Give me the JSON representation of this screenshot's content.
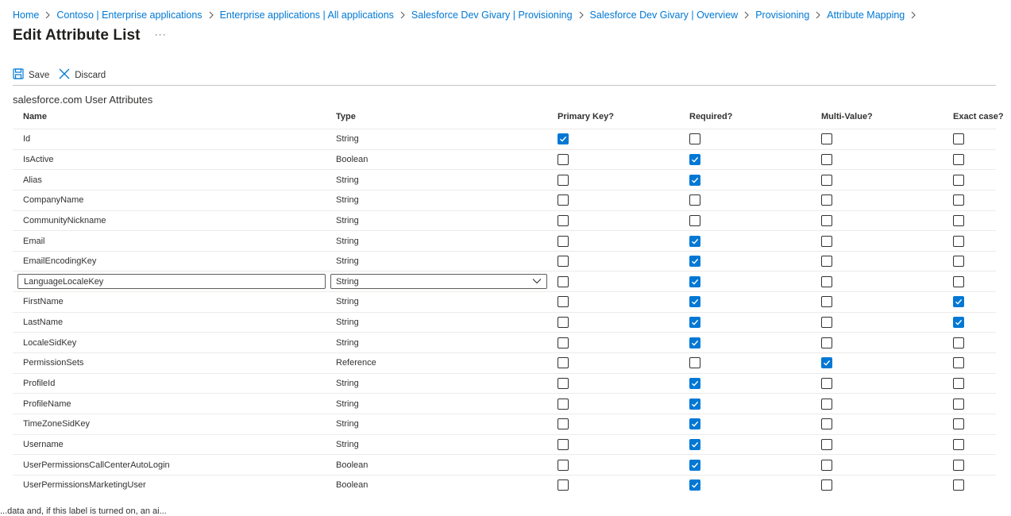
{
  "breadcrumb": [
    "Home",
    "Contoso | Enterprise applications",
    "Enterprise applications | All applications",
    "Salesforce Dev Givary | Provisioning",
    "Salesforce Dev Givary | Overview",
    "Provisioning",
    "Attribute Mapping"
  ],
  "page": {
    "title": "Edit Attribute List",
    "more_label": "···"
  },
  "toolbar": {
    "save_label": "Save",
    "discard_label": "Discard"
  },
  "section_title": "salesforce.com User Attributes",
  "columns": [
    "Name",
    "Type",
    "Primary Key?",
    "Required?",
    "Multi-Value?",
    "Exact case?"
  ],
  "rows": [
    {
      "name": "Id",
      "type": "String",
      "primary_key": true,
      "required": false,
      "multi_value": false,
      "exact_case": false
    },
    {
      "name": "IsActive",
      "type": "Boolean",
      "primary_key": false,
      "required": true,
      "multi_value": false,
      "exact_case": false
    },
    {
      "name": "Alias",
      "type": "String",
      "primary_key": false,
      "required": true,
      "multi_value": false,
      "exact_case": false
    },
    {
      "name": "CompanyName",
      "type": "String",
      "primary_key": false,
      "required": false,
      "multi_value": false,
      "exact_case": false
    },
    {
      "name": "CommunityNickname",
      "type": "String",
      "primary_key": false,
      "required": false,
      "multi_value": false,
      "exact_case": false
    },
    {
      "name": "Email",
      "type": "String",
      "primary_key": false,
      "required": true,
      "multi_value": false,
      "exact_case": false
    },
    {
      "name": "EmailEncodingKey",
      "type": "String",
      "primary_key": false,
      "required": true,
      "multi_value": false,
      "exact_case": false
    },
    {
      "name": "LanguageLocaleKey",
      "type": "String",
      "primary_key": false,
      "required": true,
      "multi_value": false,
      "exact_case": false,
      "editing": true
    },
    {
      "name": "FirstName",
      "type": "String",
      "primary_key": false,
      "required": true,
      "multi_value": false,
      "exact_case": true
    },
    {
      "name": "LastName",
      "type": "String",
      "primary_key": false,
      "required": true,
      "multi_value": false,
      "exact_case": true
    },
    {
      "name": "LocaleSidKey",
      "type": "String",
      "primary_key": false,
      "required": true,
      "multi_value": false,
      "exact_case": false
    },
    {
      "name": "PermissionSets",
      "type": "Reference",
      "primary_key": false,
      "required": false,
      "multi_value": true,
      "exact_case": false
    },
    {
      "name": "ProfileId",
      "type": "String",
      "primary_key": false,
      "required": true,
      "multi_value": false,
      "exact_case": false
    },
    {
      "name": "ProfileName",
      "type": "String",
      "primary_key": false,
      "required": true,
      "multi_value": false,
      "exact_case": false
    },
    {
      "name": "TimeZoneSidKey",
      "type": "String",
      "primary_key": false,
      "required": true,
      "multi_value": false,
      "exact_case": false
    },
    {
      "name": "Username",
      "type": "String",
      "primary_key": false,
      "required": true,
      "multi_value": false,
      "exact_case": false
    },
    {
      "name": "UserPermissionsCallCenterAutoLogin",
      "type": "Boolean",
      "primary_key": false,
      "required": true,
      "multi_value": false,
      "exact_case": false
    },
    {
      "name": "UserPermissionsMarketingUser",
      "type": "Boolean",
      "primary_key": false,
      "required": true,
      "multi_value": false,
      "exact_case": false
    }
  ],
  "footer_text": "...data and, if this label is turned on, an ai...",
  "colors": {
    "accent": "#0078d4",
    "text": "#323130",
    "link": "#0078d4"
  },
  "icons": {
    "save": "save-icon",
    "discard": "close-icon",
    "separator": "chevron-right-icon",
    "dropdown": "chevron-down-icon"
  }
}
